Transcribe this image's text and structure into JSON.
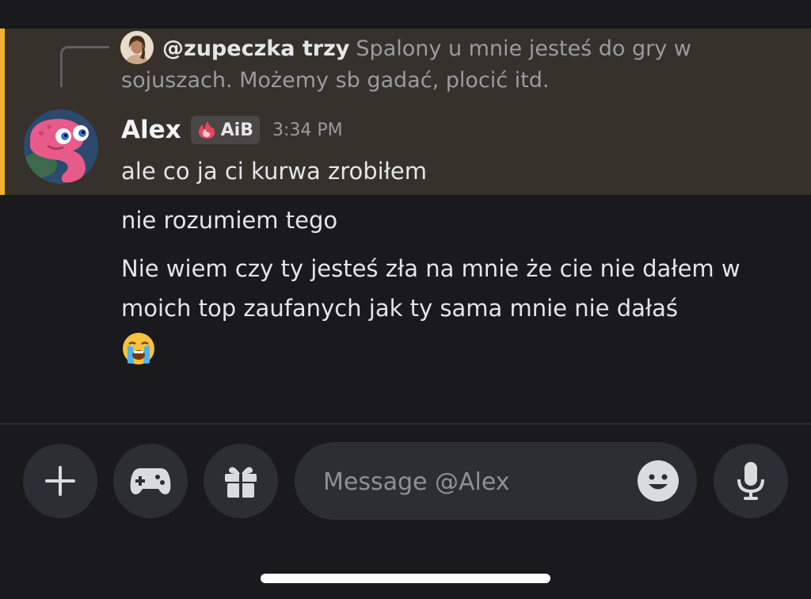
{
  "reply": {
    "author": "@zupeczka trzy",
    "text": "Spalony u mnie jesteś do gry w sojuszach. Możemy sb gadać, plocić itd.",
    "avatar_icon": "user-avatar-woman"
  },
  "message": {
    "author": "Alex",
    "tag": "AiB",
    "tag_icon": "flame-icon",
    "timestamp": "3:34 PM",
    "avatar_icon": "pink-creature-avatar",
    "lines": [
      "ale co ja ci kurwa zrobiłem",
      "nie rozumiem tego",
      "Nie wiem czy ty jesteś zła na mnie że cie nie dałem w moich top zaufanych jak ty sama mnie nie dałaś"
    ],
    "emoji": "loudly-crying-face"
  },
  "composer": {
    "placeholder": "Message @Alex",
    "buttons": [
      "plus-icon",
      "gamepad-icon",
      "gift-icon",
      "microphone-icon"
    ],
    "emoji_icon": "smiley-icon"
  },
  "colors": {
    "background": "#1a1a1e",
    "highlight": "#36312a",
    "highlight_bar": "#f0b132",
    "button_bg": "#2d2e33"
  }
}
